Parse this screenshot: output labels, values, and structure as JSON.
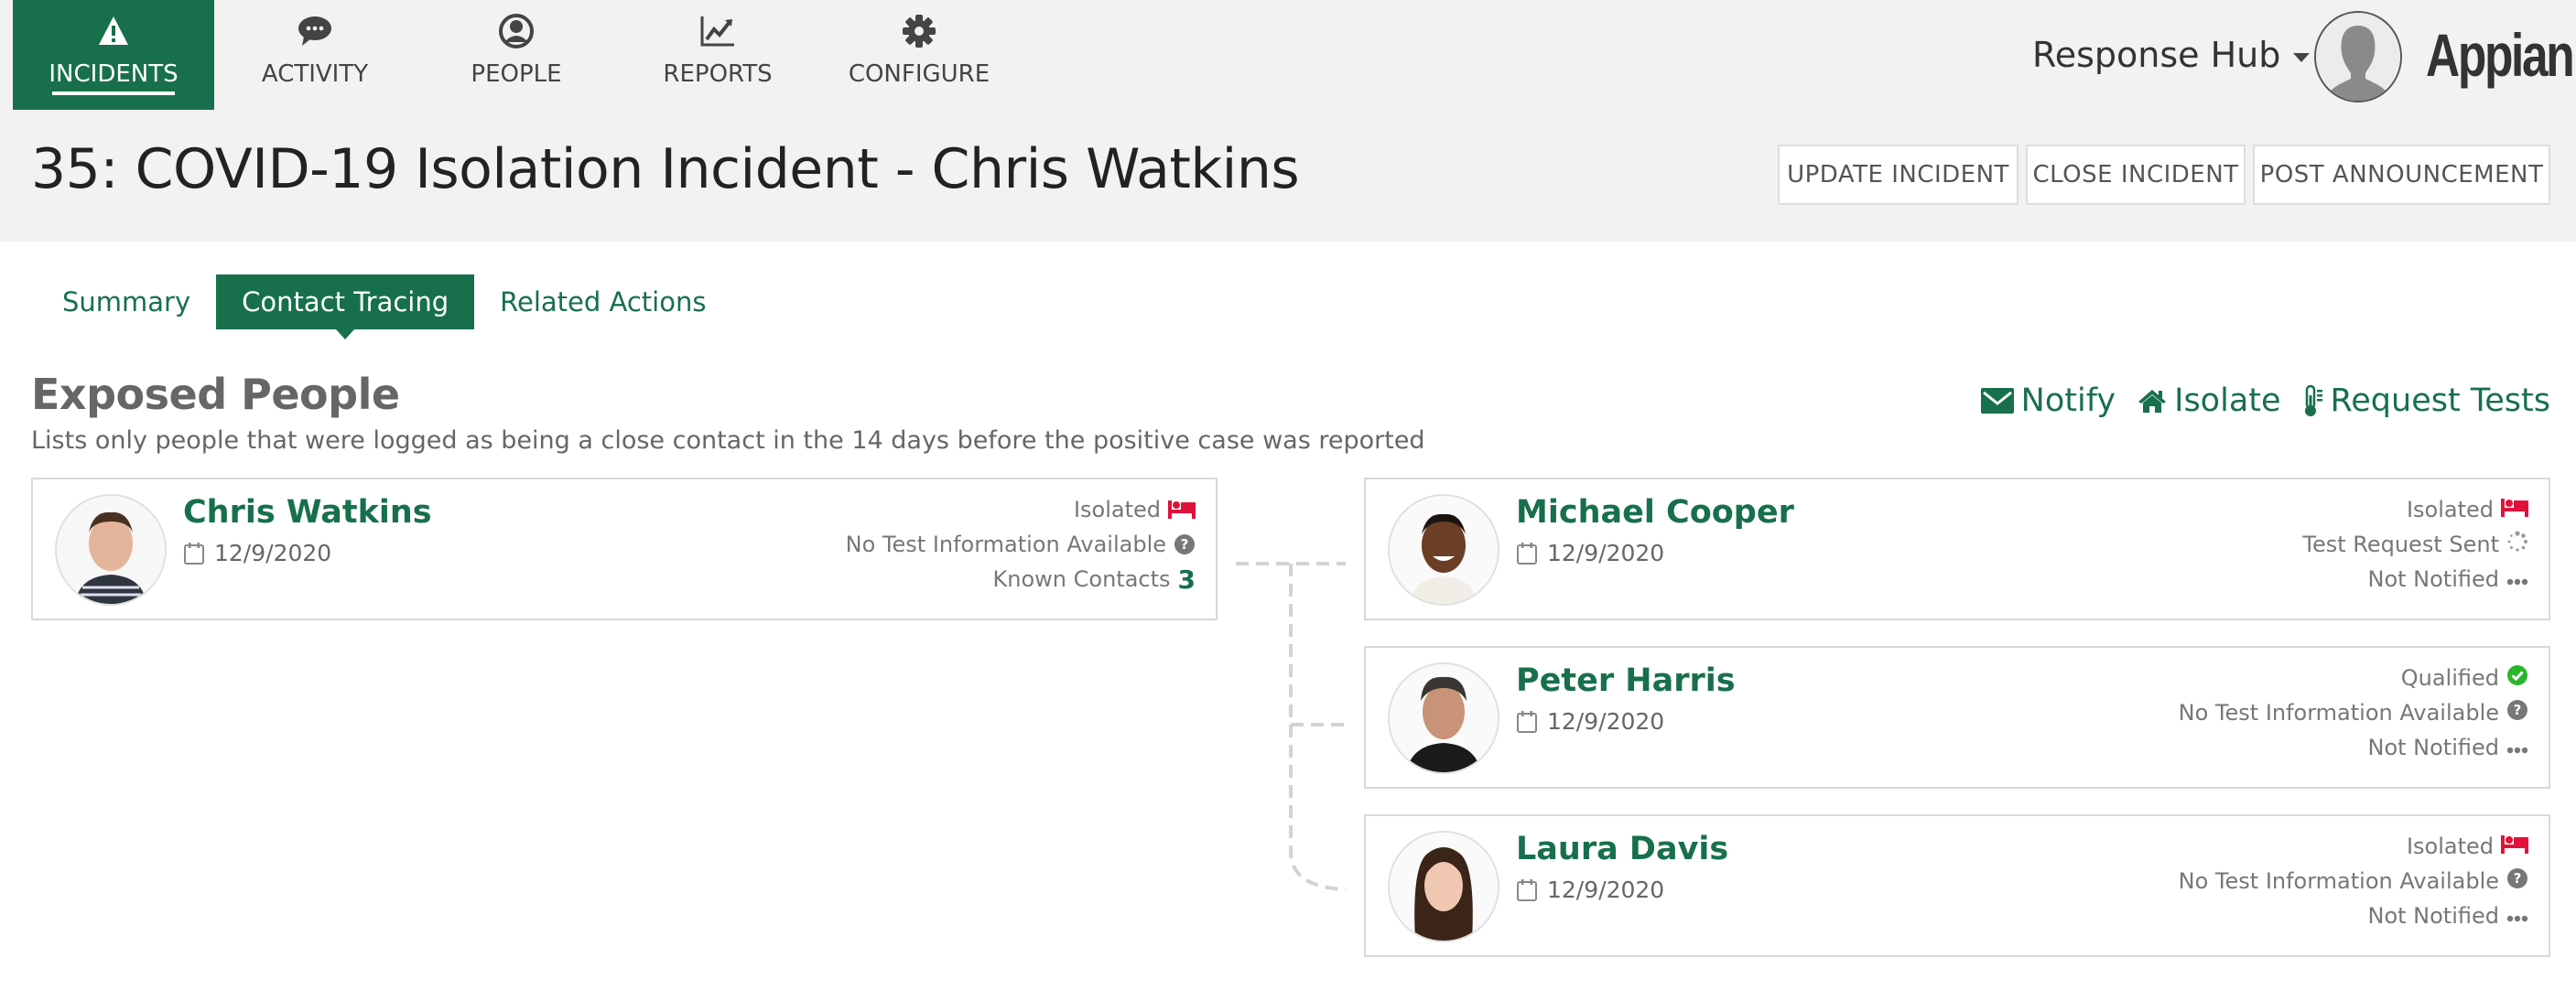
{
  "nav": {
    "items": [
      {
        "label": "INCIDENTS",
        "icon": "warning-icon",
        "active": true
      },
      {
        "label": "ACTIVITY",
        "icon": "chat-icon",
        "active": false
      },
      {
        "label": "PEOPLE",
        "icon": "user-icon",
        "active": false
      },
      {
        "label": "REPORTS",
        "icon": "line-chart-icon",
        "active": false
      },
      {
        "label": "CONFIGURE",
        "icon": "gear-icon",
        "active": false
      }
    ],
    "app_name": "Response Hub",
    "logo": "Appian"
  },
  "header": {
    "title": "35: COVID-19 Isolation Incident - Chris Watkins",
    "buttons": [
      "UPDATE INCIDENT",
      "CLOSE INCIDENT",
      "POST ANNOUNCEMENT"
    ]
  },
  "tabs": [
    {
      "label": "Summary",
      "active": false
    },
    {
      "label": "Contact Tracing",
      "active": true
    },
    {
      "label": "Related Actions",
      "active": false
    }
  ],
  "section": {
    "title": "Exposed People",
    "subtitle": "Lists only people that were logged as being a close contact in the 14 days before the positive case was reported",
    "actions": [
      {
        "label": "Notify",
        "icon": "envelope-icon"
      },
      {
        "label": "Isolate",
        "icon": "home-icon"
      },
      {
        "label": "Request Tests",
        "icon": "thermometer-icon"
      }
    ]
  },
  "colors": {
    "brand_green": "#17704b",
    "isolated_red": "#e0123c",
    "qualified_green": "#2cb52c",
    "neutral_icon": "#777777"
  },
  "source_person": {
    "name": "Chris Watkins",
    "date": "12/9/2020",
    "status": "Isolated",
    "test": "No Test Information Available",
    "contacts_label": "Known Contacts",
    "contacts_count": "3"
  },
  "contacts": [
    {
      "name": "Michael Cooper",
      "date": "12/9/2020",
      "status": "Isolated",
      "status_icon": "bed-icon",
      "test": "Test Request Sent",
      "test_icon": "spinner-icon",
      "notification": "Not Notified"
    },
    {
      "name": "Peter Harris",
      "date": "12/9/2020",
      "status": "Qualified",
      "status_icon": "check-circle-icon",
      "test": "No Test Information Available",
      "test_icon": "question-circle-icon",
      "notification": "Not Notified"
    },
    {
      "name": "Laura Davis",
      "date": "12/9/2020",
      "status": "Isolated",
      "status_icon": "bed-icon",
      "test": "No Test Information Available",
      "test_icon": "question-circle-icon",
      "notification": "Not Notified"
    }
  ]
}
